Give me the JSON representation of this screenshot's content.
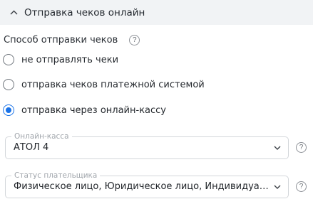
{
  "section": {
    "title": "Отправка чеков онлайн",
    "expanded": true
  },
  "sending_method": {
    "label": "Способ отправки чеков",
    "help": "?",
    "options": [
      {
        "label": "не отправлять чеки",
        "checked": false
      },
      {
        "label": "отправка чеков платежной системой",
        "checked": false
      },
      {
        "label": "отправка через онлайн-кассу",
        "checked": true
      }
    ]
  },
  "online_cash_register": {
    "legend": "Онлайн-касса",
    "value": "АТОЛ 4",
    "help": "?"
  },
  "payer_status": {
    "legend": "Статус плательщика",
    "value": "Физическое лицо, Юридическое лицо, Индивидуальный предприниматель",
    "help": "?"
  },
  "colors": {
    "accent": "#1a73e8",
    "header_bg": "#f1f3f5",
    "border": "#d3d6da"
  }
}
